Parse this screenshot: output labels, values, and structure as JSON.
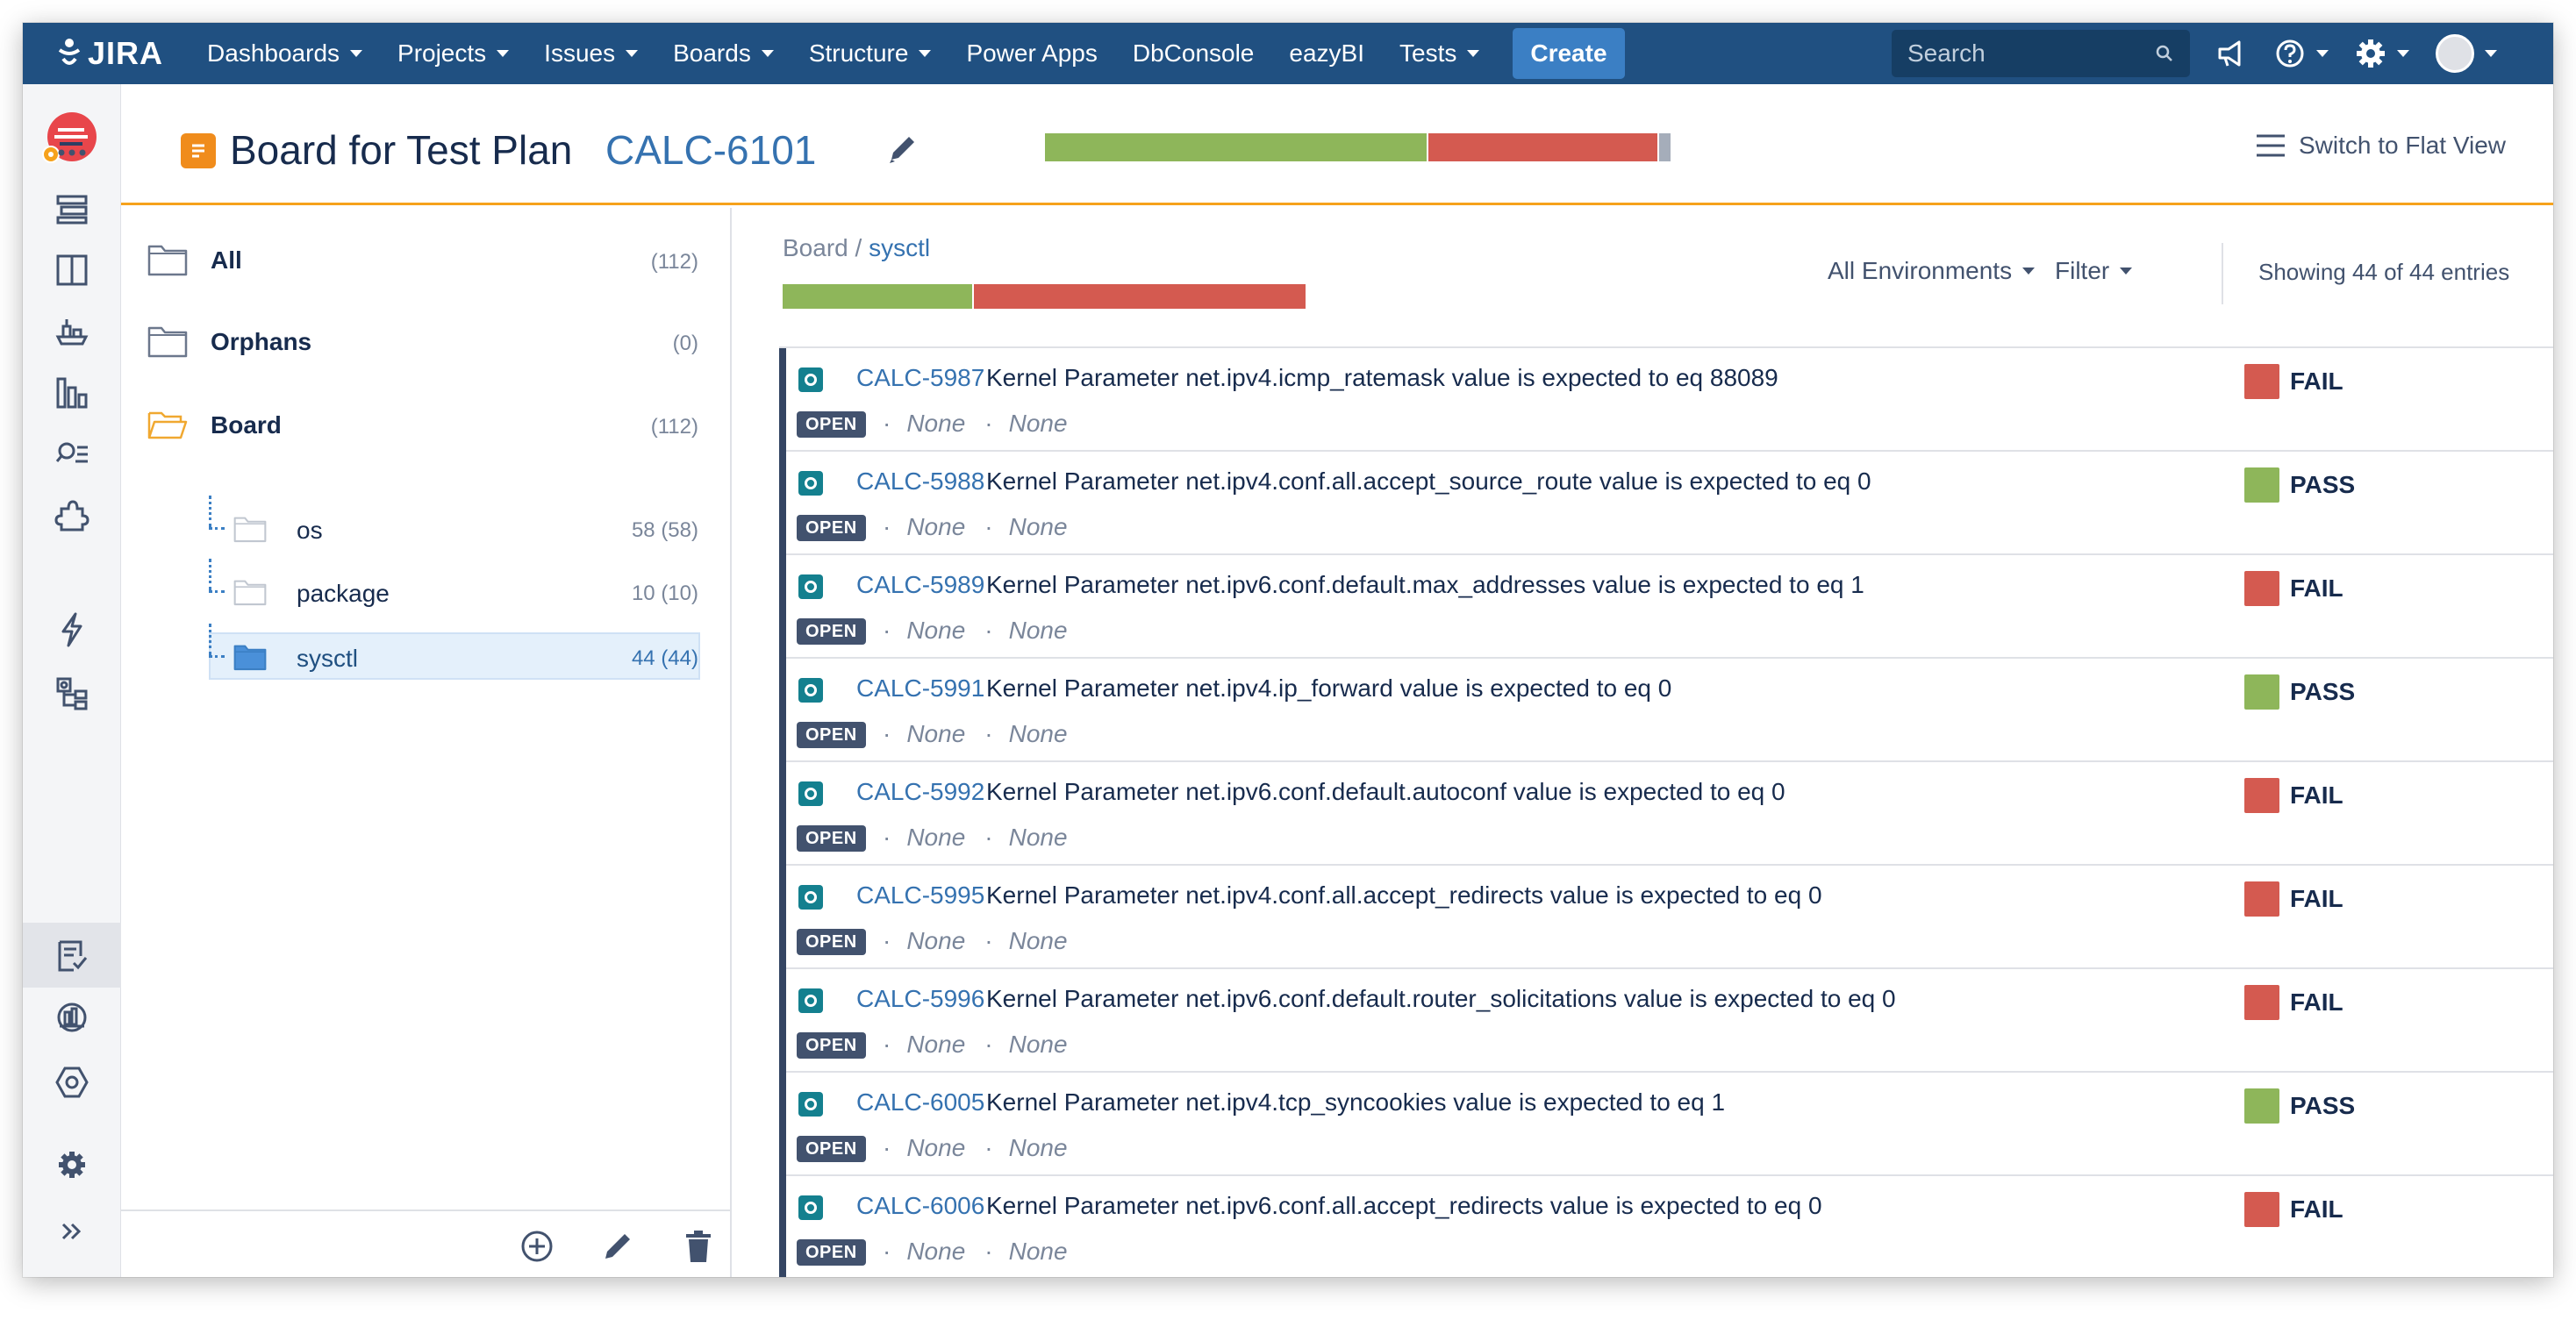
{
  "colors": {
    "nav_bg": "#205081",
    "pass": "#8eb65a",
    "fail": "#d45a50",
    "unexecuted": "#a5adba",
    "accent_orange": "#f6a21c",
    "link": "#3572b0"
  },
  "nav": {
    "logo_text": "JIRA",
    "items": [
      {
        "label": "Dashboards",
        "has_caret": true
      },
      {
        "label": "Projects",
        "has_caret": true
      },
      {
        "label": "Issues",
        "has_caret": true
      },
      {
        "label": "Boards",
        "has_caret": true
      },
      {
        "label": "Structure",
        "has_caret": true
      },
      {
        "label": "Power Apps",
        "has_caret": false
      },
      {
        "label": "DbConsole",
        "has_caret": false
      },
      {
        "label": "eazyBI",
        "has_caret": false
      },
      {
        "label": "Tests",
        "has_caret": true
      }
    ],
    "create_label": "Create",
    "search_placeholder": "Search"
  },
  "header": {
    "title": "Board for Test Plan",
    "plan_key": "CALC-6101",
    "progress": {
      "pass": 0.375,
      "fail": 0.225,
      "unexecuted": 0.011
    },
    "flat_view_label": "Switch to Flat View"
  },
  "tree": {
    "items": [
      {
        "label": "All",
        "count": "(112)"
      },
      {
        "label": "Orphans",
        "count": "(0)"
      },
      {
        "label": "Board",
        "count": "(112)"
      }
    ],
    "children": [
      {
        "label": "os",
        "count": "58 (58)"
      },
      {
        "label": "package",
        "count": "10 (10)"
      },
      {
        "label": "sysctl",
        "count": "44 (44)"
      }
    ]
  },
  "board": {
    "breadcrumb_root": "Board",
    "breadcrumb_sep": " / ",
    "breadcrumb_current": "sysctl",
    "progress": {
      "pass": 0.195,
      "fail": 0.34
    },
    "environment_label": "All Environments",
    "filter_label": "Filter",
    "showing_text": "Showing 44 of 44 entries"
  },
  "tests": [
    {
      "key": "CALC-5987",
      "summary": "Kernel Parameter net.ipv4.icmp_ratemask value is expected to eq 88089",
      "status": "OPEN",
      "meta1": "None",
      "meta2": "None",
      "result": "FAIL"
    },
    {
      "key": "CALC-5988",
      "summary": "Kernel Parameter net.ipv4.conf.all.accept_source_route value is expected to eq 0",
      "status": "OPEN",
      "meta1": "None",
      "meta2": "None",
      "result": "PASS"
    },
    {
      "key": "CALC-5989",
      "summary": "Kernel Parameter net.ipv6.conf.default.max_addresses value is expected to eq 1",
      "status": "OPEN",
      "meta1": "None",
      "meta2": "None",
      "result": "FAIL"
    },
    {
      "key": "CALC-5991",
      "summary": "Kernel Parameter net.ipv4.ip_forward value is expected to eq 0",
      "status": "OPEN",
      "meta1": "None",
      "meta2": "None",
      "result": "PASS"
    },
    {
      "key": "CALC-5992",
      "summary": "Kernel Parameter net.ipv6.conf.default.autoconf value is expected to eq 0",
      "status": "OPEN",
      "meta1": "None",
      "meta2": "None",
      "result": "FAIL"
    },
    {
      "key": "CALC-5995",
      "summary": "Kernel Parameter net.ipv4.conf.all.accept_redirects value is expected to eq 0",
      "status": "OPEN",
      "meta1": "None",
      "meta2": "None",
      "result": "FAIL"
    },
    {
      "key": "CALC-5996",
      "summary": "Kernel Parameter net.ipv6.conf.default.router_solicitations value is expected to eq 0",
      "status": "OPEN",
      "meta1": "None",
      "meta2": "None",
      "result": "FAIL"
    },
    {
      "key": "CALC-6005",
      "summary": "Kernel Parameter net.ipv4.tcp_syncookies value is expected to eq 1",
      "status": "OPEN",
      "meta1": "None",
      "meta2": "None",
      "result": "PASS"
    },
    {
      "key": "CALC-6006",
      "summary": "Kernel Parameter net.ipv6.conf.all.accept_redirects value is expected to eq 0",
      "status": "OPEN",
      "meta1": "None",
      "meta2": "None",
      "result": "FAIL"
    }
  ]
}
